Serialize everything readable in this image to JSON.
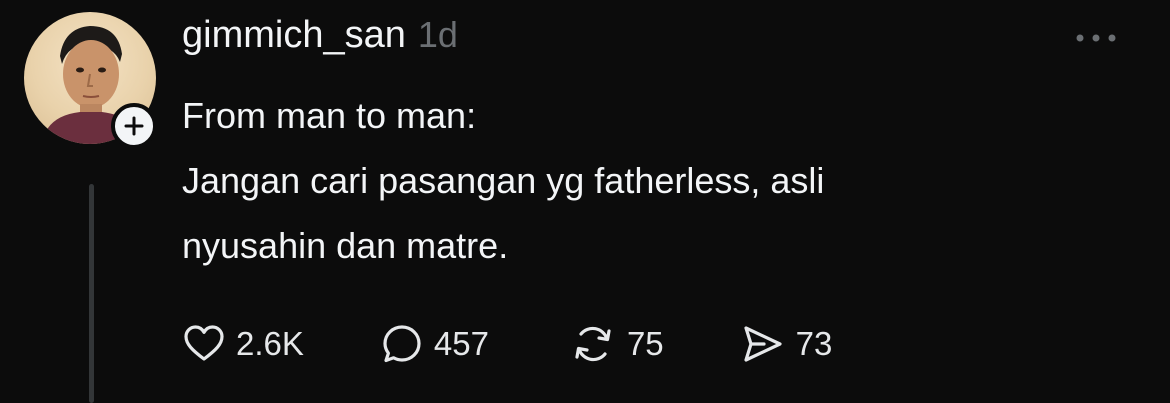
{
  "post": {
    "author": {
      "username": "gimmich_san",
      "avatar_icon": "user-avatar"
    },
    "timestamp": "1d",
    "lines": [
      "From man to man:",
      "Jangan cari pasangan yg fatherless, asli",
      "nyusahin dan matre."
    ],
    "follow_icon": "plus-icon",
    "more_icon": "ellipsis-icon"
  },
  "actions": {
    "like": {
      "icon": "heart-icon",
      "count": "2.6K"
    },
    "reply": {
      "icon": "comment-bubble-icon",
      "count": "457"
    },
    "repost": {
      "icon": "repost-icon",
      "count": "75"
    },
    "share": {
      "icon": "send-icon",
      "count": "73"
    }
  },
  "colors": {
    "background": "#0c0c0c",
    "primary_text": "#f3f5f7",
    "secondary_text": "#6b6f73",
    "thread_line": "#333638"
  }
}
